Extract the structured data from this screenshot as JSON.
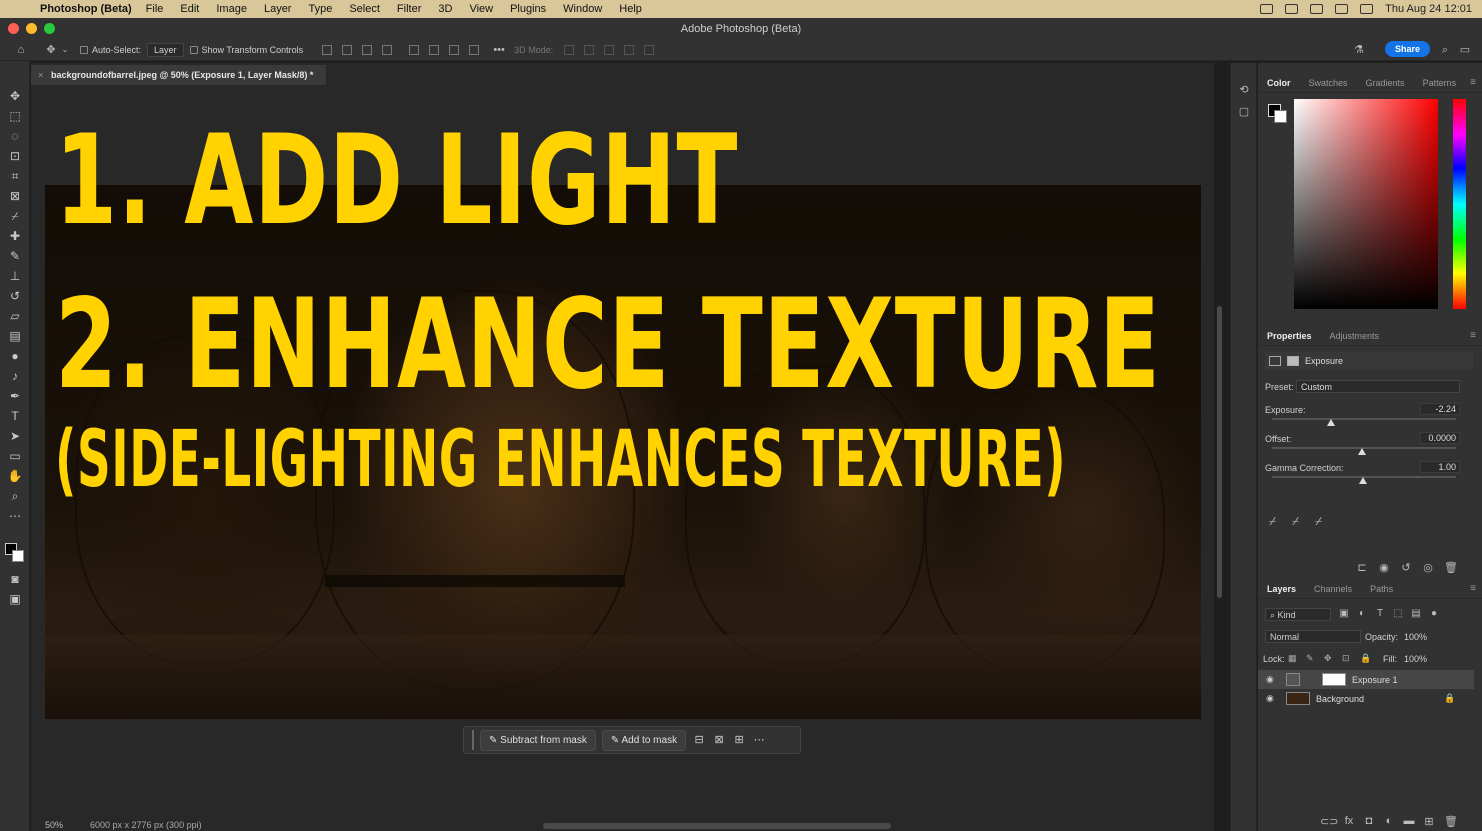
{
  "menubar": {
    "app_name": "Photoshop (Beta)",
    "items": [
      "File",
      "Edit",
      "Image",
      "Layer",
      "Type",
      "Select",
      "Filter",
      "3D",
      "View",
      "Plugins",
      "Window",
      "Help"
    ],
    "clock": "Thu Aug 24  12:01"
  },
  "window": {
    "title": "Adobe Photoshop (Beta)"
  },
  "options_bar": {
    "auto_select_label": "Auto-Select:",
    "auto_select_value": "Layer",
    "show_transform_label": "Show Transform Controls",
    "mode_3d_label": "3D Mode:",
    "share_label": "Share"
  },
  "document": {
    "tab_title": "backgroundofbarrel.jpeg @ 50% (Exposure 1, Layer Mask/8) *",
    "overlay_line1": "1. ADD LIGHT",
    "overlay_line2": "2. ENHANCE TEXTURE",
    "overlay_line3": "(SIDE-LIGHTING ENHANCES TEXTURE)",
    "zoom": "50%",
    "dimensions": "6000 px x 2776 px (300 ppi)"
  },
  "contextual_taskbar": {
    "subtract_label": "Subtract from mask",
    "add_label": "Add to mask"
  },
  "color_panel": {
    "tabs": [
      "Color",
      "Swatches",
      "Gradients",
      "Patterns"
    ],
    "foreground": "#000000",
    "background": "#ffffff"
  },
  "properties_panel": {
    "tabs": [
      "Properties",
      "Adjustments"
    ],
    "adjustment_name": "Exposure",
    "preset_label": "Preset:",
    "preset_value": "Custom",
    "exposure_label": "Exposure:",
    "exposure_value": "-2.24",
    "offset_label": "Offset:",
    "offset_value": "0.0000",
    "gamma_label": "Gamma Correction:",
    "gamma_value": "1.00"
  },
  "layers_panel": {
    "tabs": [
      "Layers",
      "Channels",
      "Paths"
    ],
    "filter_kind": "Kind",
    "blend_mode": "Normal",
    "opacity_label": "Opacity:",
    "opacity_value": "100%",
    "lock_label": "Lock:",
    "fill_label": "Fill:",
    "fill_value": "100%",
    "layers": [
      {
        "name": "Exposure 1"
      },
      {
        "name": "Background"
      }
    ]
  },
  "colors": {
    "accent": "#1473e6",
    "overlay_text": "#ffd200"
  }
}
